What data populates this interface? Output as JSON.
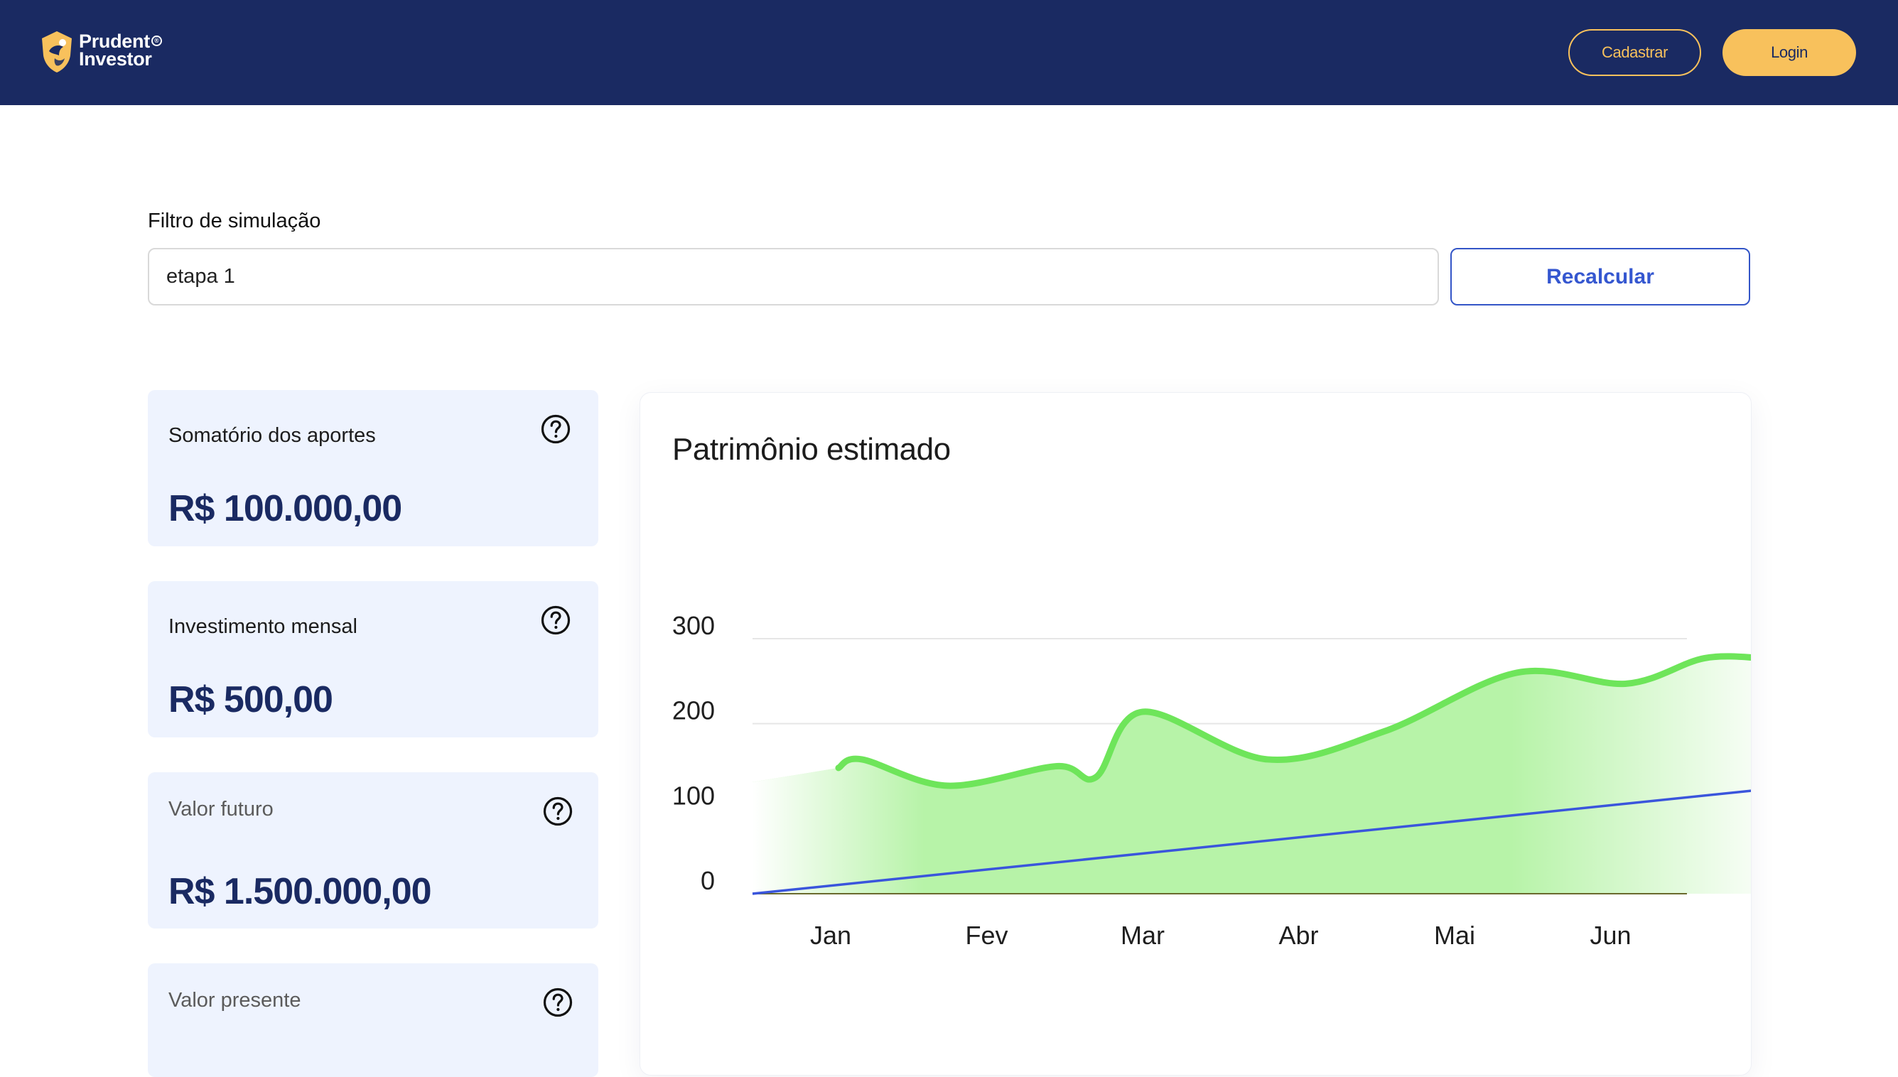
{
  "header": {
    "logo_line1": "Prudent",
    "logo_line2": "Investor",
    "logo_registered": "®",
    "signup_label": "Cadastrar",
    "login_label": "Login"
  },
  "filter": {
    "label": "Filtro de simulação",
    "value": "etapa 1",
    "button_label": "Recalcular"
  },
  "cards": [
    {
      "label": "Somatório dos aportes",
      "value": "R$ 100.000,00"
    },
    {
      "label": "Investimento mensal",
      "value": "R$ 500,00"
    },
    {
      "label": "Valor futuro",
      "value": "R$ 1.500.000,00"
    },
    {
      "label": "Valor presente",
      "value": ""
    }
  ],
  "colors": {
    "header_bg": "#1a2a62",
    "accent_yellow": "#f8c15c",
    "primary_blue": "#3557d0",
    "card_bg": "#eef3fe",
    "area_green": "#6ee55a",
    "line_blue": "#3a55dc"
  },
  "icons": [
    "logo-shield-icon",
    "help-circle-icon"
  ],
  "chart_data": {
    "type": "line",
    "title": "Patrimônio estimado",
    "categories": [
      "Jan",
      "Fev",
      "Mar",
      "Abr",
      "Mai",
      "Jun"
    ],
    "ylim": [
      0,
      300
    ],
    "yticks": [
      0,
      100,
      200,
      300
    ],
    "grid": true,
    "series": [
      {
        "style": "area",
        "color": "#6ee55a",
        "x": [
          0.05,
          0.2,
          0.75,
          1.45,
          1.7,
          2.0,
          2.8,
          3.55,
          4.4,
          5.1,
          5.6,
          5.98
        ],
        "values": [
          148,
          158,
          127,
          150,
          137,
          214,
          158,
          191,
          260,
          247,
          277,
          277
        ]
      },
      {
        "style": "line",
        "color": "#3a55dc",
        "x": [
          0,
          5.95
        ],
        "values": [
          0,
          122
        ]
      }
    ]
  }
}
